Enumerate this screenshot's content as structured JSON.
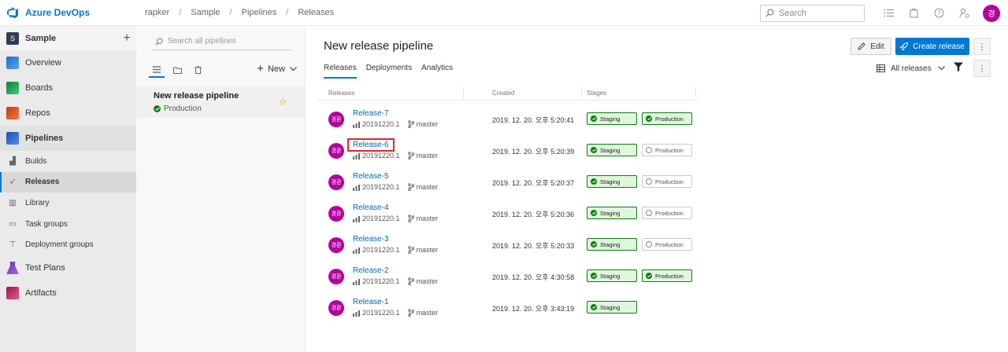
{
  "app": {
    "brand": "Azure DevOps"
  },
  "breadcrumb": [
    "rapker",
    "Sample",
    "Pipelines",
    "Releases"
  ],
  "search": {
    "placeholder": "Search"
  },
  "user": {
    "initials": "경"
  },
  "sidebar": {
    "project_initial": "S",
    "project_name": "Sample",
    "items": [
      {
        "label": "Overview"
      },
      {
        "label": "Boards"
      },
      {
        "label": "Repos"
      },
      {
        "label": "Pipelines"
      },
      {
        "label": "Builds"
      },
      {
        "label": "Releases"
      },
      {
        "label": "Library"
      },
      {
        "label": "Task groups"
      },
      {
        "label": "Deployment groups"
      },
      {
        "label": "Test Plans"
      },
      {
        "label": "Artifacts"
      }
    ]
  },
  "pipelines_panel": {
    "search_placeholder": "Search all pipelines",
    "new_label": "New",
    "pipeline": {
      "name": "New release pipeline",
      "environment": "Production"
    }
  },
  "main": {
    "title": "New release pipeline",
    "tabs": [
      "Releases",
      "Deployments",
      "Analytics"
    ],
    "edit_label": "Edit",
    "create_label": "Create release",
    "filter_label": "All releases",
    "columns": [
      "Releases",
      "Created",
      "Stages"
    ],
    "releases": [
      {
        "name": "Release-7",
        "avatar": "경환",
        "build": "20191220.1",
        "branch": "master",
        "created": "2019. 12. 20. 오후 5:20:41",
        "staging": "Staging",
        "staging_ok": true,
        "production": "Production",
        "production_ok": true
      },
      {
        "name": "Release-6",
        "avatar": "경환",
        "build": "20191220.1",
        "branch": "master",
        "created": "2019. 12. 20. 오후 5:20:39",
        "staging": "Staging",
        "staging_ok": true,
        "production": "Production",
        "production_ok": false
      },
      {
        "name": "Release-5",
        "avatar": "경환",
        "build": "20191220.1",
        "branch": "master",
        "created": "2019. 12. 20. 오후 5:20:37",
        "staging": "Staging",
        "staging_ok": true,
        "production": "Production",
        "production_ok": false
      },
      {
        "name": "Release-4",
        "avatar": "경환",
        "build": "20191220.1",
        "branch": "master",
        "created": "2019. 12. 20. 오후 5:20:36",
        "staging": "Staging",
        "staging_ok": true,
        "production": "Production",
        "production_ok": false
      },
      {
        "name": "Release-3",
        "avatar": "경환",
        "build": "20191220.1",
        "branch": "master",
        "created": "2019. 12. 20. 오후 5:20:33",
        "staging": "Staging",
        "staging_ok": true,
        "production": "Production",
        "production_ok": false
      },
      {
        "name": "Release-2",
        "avatar": "경환",
        "build": "20191220.1",
        "branch": "master",
        "created": "2019. 12. 20. 오후 4:30:58",
        "staging": "Staging",
        "staging_ok": true,
        "production": "Production",
        "production_ok": true
      },
      {
        "name": "Release-1",
        "avatar": "경환",
        "build": "20191220.1",
        "branch": "master",
        "created": "2019. 12. 20. 오후 3:43:19",
        "staging": "Staging",
        "staging_ok": true,
        "production": null,
        "production_ok": false
      }
    ]
  },
  "colors": {
    "accent": "#0078d4",
    "success": "#107c10",
    "avatar": "#b4009e",
    "highlight": "#e0262d"
  }
}
